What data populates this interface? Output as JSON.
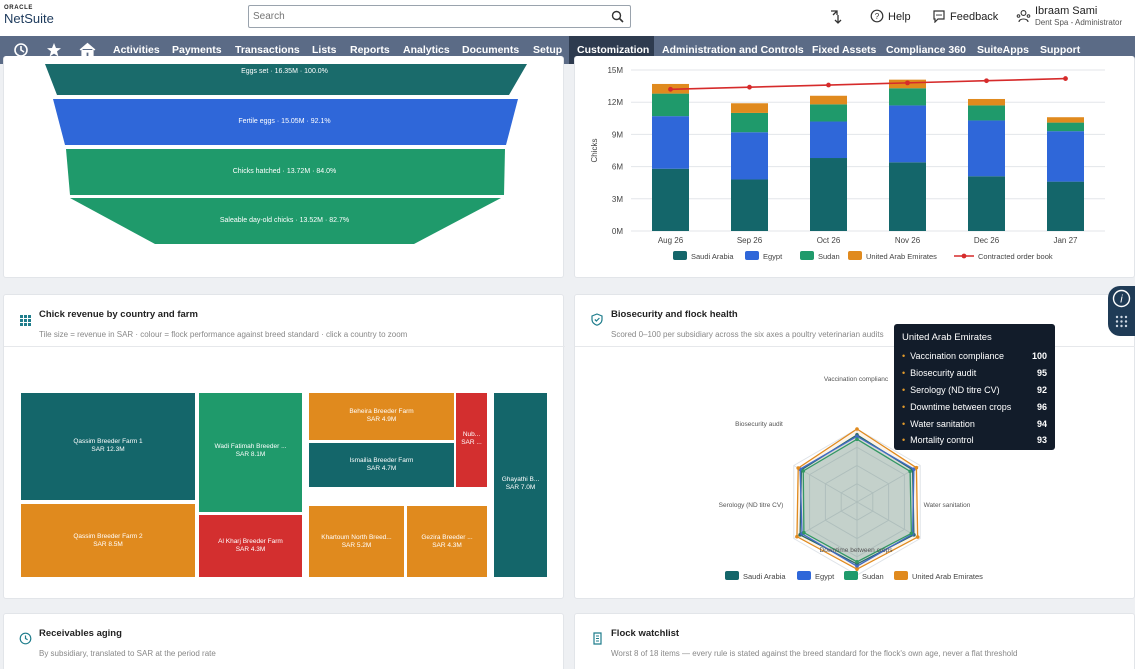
{
  "brand": {
    "oracle": "ORACLE",
    "netsuite": "NetSuite"
  },
  "search": {
    "placeholder": "Search"
  },
  "header": {
    "help": "Help",
    "feedback": "Feedback",
    "user_name": "Ibraam Sami",
    "user_role": "Dent Spa - Administrator"
  },
  "nav": {
    "items": [
      "Activities",
      "Payments",
      "Transactions",
      "Lists",
      "Reports",
      "Analytics",
      "Documents",
      "Setup",
      "Customization",
      "Administration and Controls",
      "Fixed Assets",
      "Compliance 360",
      "SuiteApps",
      "Support"
    ],
    "active": "Customization"
  },
  "funnel": {
    "stages": [
      {
        "label": "Eggs set",
        "value": "16.35M",
        "pct": "100.0%"
      },
      {
        "label": "Fertile eggs",
        "value": "15.05M",
        "pct": "92.1%"
      },
      {
        "label": "Chicks hatched",
        "value": "13.72M",
        "pct": "84.0%"
      },
      {
        "label": "Saleable day-old chicks",
        "value": "13.52M",
        "pct": "82.7%"
      }
    ],
    "colors": [
      "#1a6b6b",
      "#2f67d9",
      "#1f9a6b",
      "#1f9a6b"
    ]
  },
  "chart_data": {
    "type": "bar",
    "stacked": true,
    "categories": [
      "Aug 26",
      "Sep 26",
      "Oct 26",
      "Nov 26",
      "Dec 26",
      "Jan 27"
    ],
    "ylabel": "Chicks",
    "ylim": [
      0,
      15
    ],
    "yticks": [
      "0M",
      "3M",
      "6M",
      "9M",
      "12M",
      "15M"
    ],
    "series": [
      {
        "name": "Saudi Arabia",
        "color": "#14666a",
        "values": [
          5.8,
          4.8,
          6.8,
          6.4,
          5.1,
          4.6
        ]
      },
      {
        "name": "Egypt",
        "color": "#2f67d9",
        "values": [
          4.9,
          4.4,
          3.4,
          5.3,
          5.2,
          4.7
        ]
      },
      {
        "name": "Sudan",
        "color": "#1f9a6b",
        "values": [
          2.1,
          1.8,
          1.6,
          1.6,
          1.4,
          0.8
        ]
      },
      {
        "name": "United Arab Emirates",
        "color": "#e08a1e",
        "values": [
          0.9,
          0.9,
          0.8,
          0.8,
          0.6,
          0.5
        ]
      }
    ],
    "line": {
      "name": "Contracted order book",
      "color": "#d62b2b",
      "values": [
        13.2,
        13.4,
        13.6,
        13.8,
        14.0,
        14.2
      ]
    },
    "grid": true,
    "legend": "bottom"
  },
  "treemap": {
    "title": "Chick revenue by country and farm",
    "subtitle": "Tile size = revenue in SAR · colour = flock performance against breed standard · click a country to zoom",
    "tiles": [
      {
        "name": "Qassim Breeder Farm 1",
        "value": "SAR 12.3M",
        "color": "#14666a"
      },
      {
        "name": "Qassim Breeder Farm 2",
        "value": "SAR 8.5M",
        "color": "#e08a1e"
      },
      {
        "name": "Wadi Fatimah Breeder ...",
        "value": "SAR 8.1M",
        "color": "#1f9a6b"
      },
      {
        "name": "Al Kharj Breeder Farm",
        "value": "SAR 4.3M",
        "color": "#d32f2f"
      },
      {
        "name": "Beheira Breeder Farm",
        "value": "SAR 4.9M",
        "color": "#e08a1e"
      },
      {
        "name": "Ismailia Breeder Farm",
        "value": "SAR 4.7M",
        "color": "#14666a"
      },
      {
        "name": "Nub...",
        "value": "SAR ...",
        "color": "#d32f2f"
      },
      {
        "name": "Khartoum North Breed...",
        "value": "SAR 5.2M",
        "color": "#e08a1e"
      },
      {
        "name": "Gezira Breeder ...",
        "value": "SAR 4.3M",
        "color": "#e08a1e"
      },
      {
        "name": "Ghayathi B...",
        "value": "SAR 7.0M",
        "color": "#14666a"
      }
    ]
  },
  "radar": {
    "title": "Biosecurity and flock health",
    "subtitle": "Scored 0–100 per subsidiary across the six axes a poultry veterinarian audits",
    "axes": [
      "Vaccination compliance",
      "Water sanitation",
      "Downtime between crops",
      "Serology (ND titre CV)",
      "Biosecurity audit",
      "Mortality control"
    ],
    "axis_labels": [
      "Vaccination complianc",
      "Water sanitation",
      "Downtime between crops",
      "Serology (ND titre CV)",
      "Biosecurity audit"
    ],
    "series": [
      {
        "name": "Saudi Arabia",
        "color": "#14666a",
        "values": [
          92,
          88,
          90,
          85,
          90,
          88
        ]
      },
      {
        "name": "Egypt",
        "color": "#2f67d9",
        "values": [
          90,
          90,
          88,
          88,
          87,
          90
        ]
      },
      {
        "name": "Sudan",
        "color": "#1f9a6b",
        "values": [
          86,
          84,
          86,
          82,
          84,
          85
        ]
      },
      {
        "name": "United Arab Emirates",
        "color": "#e08a1e",
        "values": [
          100,
          94,
          96,
          92,
          95,
          93
        ]
      }
    ],
    "tooltip": {
      "title": "United Arab Emirates",
      "rows": [
        {
          "label": "Vaccination compliance",
          "value": "100"
        },
        {
          "label": "Biosecurity audit",
          "value": "95"
        },
        {
          "label": "Serology (ND titre CV)",
          "value": "92"
        },
        {
          "label": "Downtime between crops",
          "value": "96"
        },
        {
          "label": "Water sanitation",
          "value": "94"
        },
        {
          "label": "Mortality control",
          "value": "93"
        }
      ]
    }
  },
  "receivables": {
    "title": "Receivables aging",
    "subtitle": "By subsidiary, translated to SAR at the period rate"
  },
  "watchlist": {
    "title": "Flock watchlist",
    "subtitle": "Worst 8 of 18 items — every rule is stated against the breed standard for the flock's own age, never a flat threshold"
  }
}
